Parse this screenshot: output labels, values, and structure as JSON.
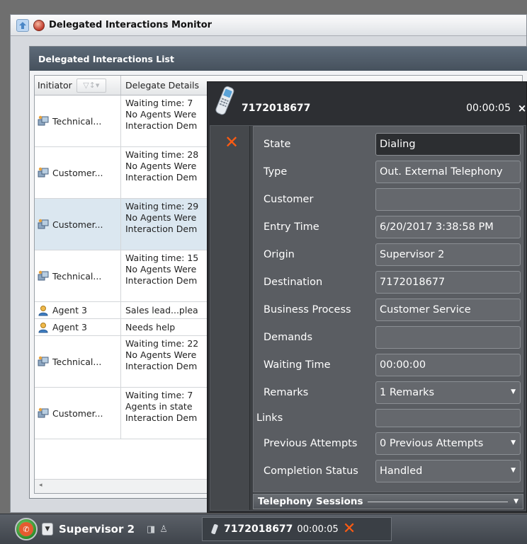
{
  "window": {
    "title": "Delegated Interactions Monitor"
  },
  "list": {
    "header": "Delegated Interactions List",
    "columns": {
      "initiator": "Initiator",
      "details": "Delegate Details"
    },
    "rows": [
      {
        "initiator": "Technical...",
        "type": "group",
        "lines": [
          "Waiting time: 7",
          "No Agents Were",
          "Interaction Dem"
        ]
      },
      {
        "initiator": "Customer...",
        "type": "group",
        "lines": [
          "Waiting time: 28",
          "No Agents Were",
          "Interaction Dem"
        ]
      },
      {
        "initiator": "Customer...",
        "type": "group",
        "lines": [
          "Waiting time: 29",
          "No Agents Were",
          "Interaction Dem"
        ]
      },
      {
        "initiator": "Technical...",
        "type": "group",
        "lines": [
          "Waiting time: 15",
          "No Agents Were",
          "Interaction Dem"
        ]
      },
      {
        "initiator": "Agent 3",
        "type": "agent",
        "lines": [
          "Sales lead...plea"
        ]
      },
      {
        "initiator": "Agent 3",
        "type": "agent",
        "lines": [
          "Needs help"
        ]
      },
      {
        "initiator": "Technical...",
        "type": "group",
        "lines": [
          "Waiting time: 22",
          "No Agents Were",
          "Interaction Dem"
        ]
      },
      {
        "initiator": "Customer...",
        "type": "group",
        "lines": [
          "Waiting time: 7",
          "Agents in state",
          "Interaction Dem"
        ]
      }
    ]
  },
  "popup": {
    "number": "7172018677",
    "timer": "00:00:05",
    "close": "×",
    "fields": {
      "state": {
        "label": "State",
        "value": "Dialing"
      },
      "type": {
        "label": "Type",
        "value": "Out. External Telephony"
      },
      "customer": {
        "label": "Customer",
        "value": ""
      },
      "entry_time": {
        "label": "Entry Time",
        "value": "6/20/2017 3:38:58 PM"
      },
      "origin": {
        "label": "Origin",
        "value": "Supervisor 2"
      },
      "destination": {
        "label": "Destination",
        "value": "7172018677"
      },
      "business_process": {
        "label": "Business Process",
        "value": "Customer Service"
      },
      "demands": {
        "label": "Demands",
        "value": ""
      },
      "waiting_time": {
        "label": "Waiting Time",
        "value": "00:00:00"
      },
      "remarks": {
        "label": "Remarks",
        "value": "1 Remarks"
      },
      "links": {
        "label": "Links",
        "value": ""
      },
      "previous_attempts": {
        "label": "Previous Attempts",
        "value": "0 Previous Attempts"
      },
      "completion_status": {
        "label": "Completion Status",
        "value": "Handled"
      }
    },
    "telephony_sessions": "Telephony Sessions"
  },
  "bottombar": {
    "user": "Supervisor 2",
    "call_number": "7172018677",
    "call_time": "00:00:05"
  },
  "colors": {
    "accent_orange": "#ff5b12",
    "selected_row": "#dbe7f0",
    "header_dark": "#46515d"
  }
}
